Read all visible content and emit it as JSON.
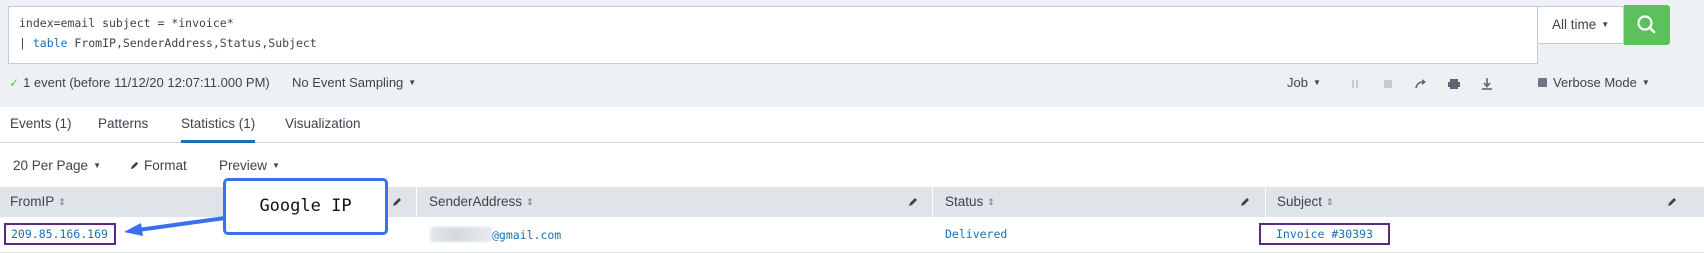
{
  "search": {
    "query_line1": "index=email subject = *invoice*",
    "query_pipe": "| ",
    "query_cmd": "table",
    "query_rest": " FromIP,SenderAddress,Status,Subject",
    "time_range": "All time"
  },
  "status": {
    "event_summary": "1 event (before 11/12/20 12:07:11.000 PM)",
    "sampling": "No Event Sampling"
  },
  "job": {
    "label": "Job",
    "icons": [
      "pause-icon",
      "stop-icon",
      "share-icon",
      "print-icon",
      "export-icon"
    ],
    "mode": "Verbose Mode"
  },
  "tabs": [
    {
      "label": "Events (1)"
    },
    {
      "label": "Patterns"
    },
    {
      "label": "Statistics (1)",
      "active": true
    },
    {
      "label": "Visualization"
    }
  ],
  "toolbar": {
    "per_page": "20 Per Page",
    "format": "Format",
    "preview": "Preview"
  },
  "table": {
    "columns": [
      "FromIP",
      "SenderAddress",
      "Status",
      "Subject"
    ],
    "rows": [
      {
        "FromIP": "209.85.166.169",
        "SenderAddress": "@gmail.com",
        "Status": "Delivered",
        "Subject": "Invoice #30393"
      }
    ]
  },
  "annotation": {
    "label": "Google IP"
  },
  "colors": {
    "accent": "#1a6fb5",
    "search_button": "#5cc05c",
    "highlight_box": "#5a2a82",
    "callout_border": "#3b6ff0"
  }
}
